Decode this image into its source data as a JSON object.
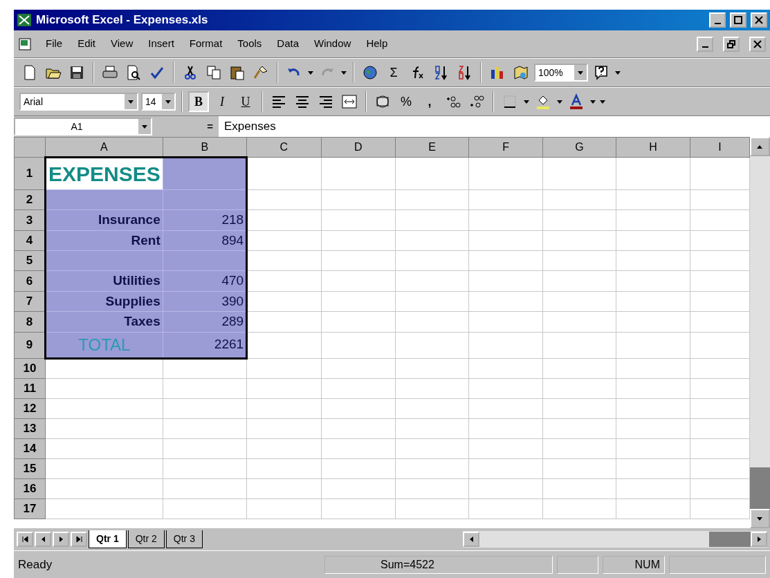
{
  "window": {
    "title": "Microsoft Excel - Expenses.xls"
  },
  "menu": [
    {
      "label": "File"
    },
    {
      "label": "Edit"
    },
    {
      "label": "View"
    },
    {
      "label": "Insert"
    },
    {
      "label": "Format"
    },
    {
      "label": "Tools"
    },
    {
      "label": "Data"
    },
    {
      "label": "Window"
    },
    {
      "label": "Help"
    }
  ],
  "standard_toolbar": {
    "sum_label": "Σ",
    "zoom": "100%"
  },
  "formatting_toolbar": {
    "font": "Arial",
    "size": "14",
    "style_buttons": [
      {
        "label": "B",
        "pressed": true
      },
      {
        "label": "I",
        "pressed": false
      },
      {
        "label": "U",
        "pressed": false
      }
    ],
    "percent_label": "%",
    "comma_label": ","
  },
  "formula_bar": {
    "name_box": "A1",
    "equals": "=",
    "content": "Expenses"
  },
  "columns": [
    "A",
    "B",
    "C",
    "D",
    "E",
    "F",
    "G",
    "H",
    "I"
  ],
  "rows": [
    {
      "header": "1",
      "cells": [
        {
          "text": "EXPENSES",
          "kind": "heading",
          "selected": true,
          "active": true
        },
        {
          "selected": true,
          "active": false
        }
      ]
    },
    {
      "header": "2",
      "cells": [
        {
          "selected": true,
          "active": false
        },
        {
          "selected": true,
          "active": false
        }
      ]
    },
    {
      "header": "3",
      "cells": [
        {
          "text": "Insurance",
          "kind": "label",
          "selected": true,
          "active": false
        },
        {
          "text": "218",
          "kind": "number",
          "selected": true,
          "active": false
        }
      ]
    },
    {
      "header": "4",
      "cells": [
        {
          "text": "Rent",
          "kind": "label",
          "selected": true,
          "active": false
        },
        {
          "text": "894",
          "kind": "number",
          "selected": true,
          "active": false
        }
      ]
    },
    {
      "header": "5",
      "cells": [
        {
          "selected": true,
          "active": false
        },
        {
          "selected": true,
          "active": false
        }
      ]
    },
    {
      "header": "6",
      "cells": [
        {
          "text": "Utilities",
          "kind": "label",
          "selected": true,
          "active": false
        },
        {
          "text": "470",
          "kind": "number",
          "selected": true,
          "active": false
        }
      ]
    },
    {
      "header": "7",
      "cells": [
        {
          "text": "Supplies",
          "kind": "label",
          "selected": true,
          "active": false
        },
        {
          "text": "390",
          "kind": "number",
          "selected": true,
          "active": false
        }
      ]
    },
    {
      "header": "8",
      "cells": [
        {
          "text": "Taxes",
          "kind": "label",
          "selected": true,
          "active": false
        },
        {
          "text": "289",
          "kind": "number",
          "selected": true,
          "active": false
        }
      ]
    },
    {
      "header": "9",
      "cells": [
        {
          "text": "TOTAL",
          "kind": "total",
          "selected": true,
          "active": false
        },
        {
          "text": "2261",
          "kind": "number",
          "selected": true,
          "active": false
        }
      ]
    },
    {
      "header": "10"
    },
    {
      "header": "11"
    },
    {
      "header": "12"
    },
    {
      "header": "13"
    },
    {
      "header": "14"
    },
    {
      "header": "15"
    },
    {
      "header": "16"
    },
    {
      "header": "17"
    }
  ],
  "sheet_tabs": [
    {
      "label": "Qtr 1",
      "selected": true
    },
    {
      "label": "Qtr 2",
      "selected": false
    },
    {
      "label": "Qtr 3",
      "selected": false
    }
  ],
  "status_bar": {
    "mode": "Ready",
    "sum": "Sum=4522",
    "num": "NUM"
  }
}
